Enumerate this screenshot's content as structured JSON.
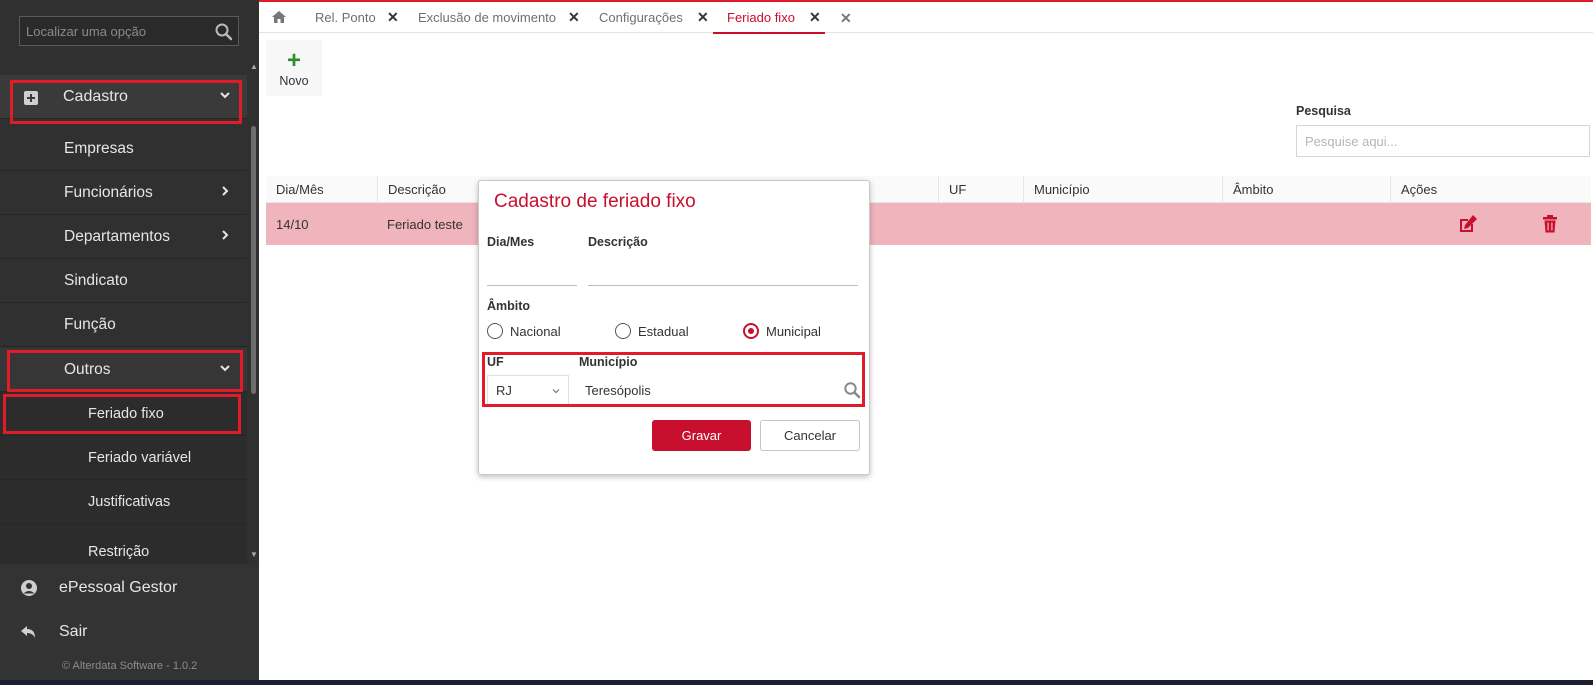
{
  "sidebar": {
    "search_placeholder": "Localizar uma opção",
    "items": [
      {
        "label": "Cadastro"
      },
      {
        "label": "Empresas"
      },
      {
        "label": "Funcionários"
      },
      {
        "label": "Departamentos"
      },
      {
        "label": "Sindicato"
      },
      {
        "label": "Função"
      },
      {
        "label": "Outros"
      },
      {
        "label": "Feriado fixo"
      },
      {
        "label": "Feriado variável"
      },
      {
        "label": "Justificativas"
      },
      {
        "label": "Restrição"
      }
    ],
    "footer": {
      "gestor_label": "ePessoal Gestor",
      "sair_label": "Sair",
      "copyright": "© Alterdata Software - 1.0.2"
    }
  },
  "tabs": [
    {
      "label": "Rel. Ponto"
    },
    {
      "label": "Exclusão de movimento"
    },
    {
      "label": "Configurações"
    },
    {
      "label": "Feriado fixo"
    }
  ],
  "toolbar": {
    "novo_label": "Novo"
  },
  "search": {
    "label": "Pesquisa",
    "placeholder": "Pesquise aqui..."
  },
  "table": {
    "columns": [
      "Dia/Mês",
      "Descrição",
      "UF",
      "Município",
      "Âmbito",
      "Ações"
    ],
    "rows": [
      {
        "dia_mes": "14/10",
        "descricao": "Feriado teste"
      }
    ]
  },
  "modal": {
    "title": "Cadastro de feriado fixo",
    "dia_mes_label": "Dia/Mes",
    "descricao_label": "Descrição",
    "ambito_label": "Âmbito",
    "options": [
      "Nacional",
      "Estadual",
      "Municipal"
    ],
    "selected_option": "Municipal",
    "uf_label": "UF",
    "uf_value": "RJ",
    "municipio_label": "Município",
    "municipio_value": "Teresópolis",
    "save_label": "Gravar",
    "cancel_label": "Cancelar"
  },
  "colors": {
    "accent": "#c8102e",
    "highlight": "#e01b2a",
    "row_highlight": "#f0b4bc",
    "sidebar_bg": "#303030"
  }
}
